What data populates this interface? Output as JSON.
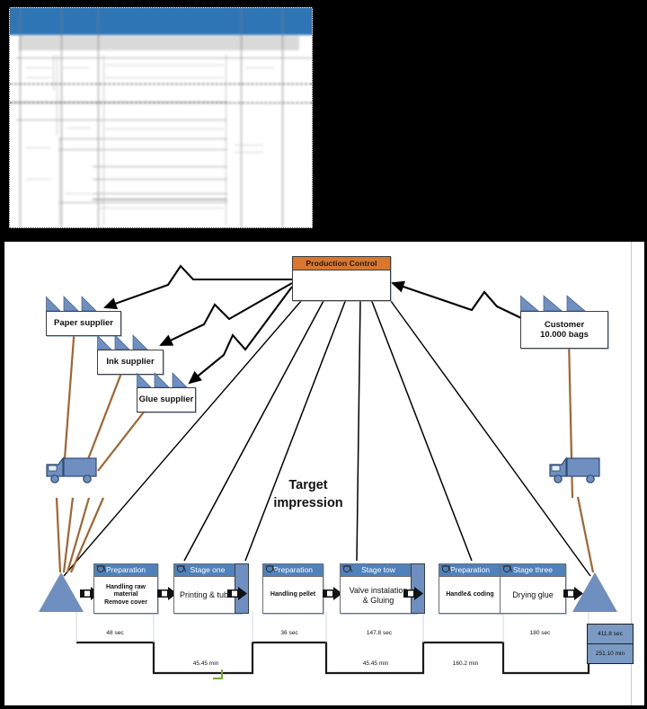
{
  "spreadsheet": {
    "name": "blurred-spreadsheet",
    "header_color": "#2e75b6",
    "subheader_color": "#d9d9d9",
    "visible_text": ""
  },
  "diagram": {
    "type": "value-stream-map",
    "center_label": "Target\nimpression",
    "center_label_line1": "Target",
    "center_label_line2": "impression",
    "production_control": {
      "title": "Production Control",
      "title_color": "#d9772f"
    },
    "suppliers": [
      {
        "label": "Paper supplier",
        "icon": "factory-icon"
      },
      {
        "label": "Ink supplier",
        "icon": "factory-icon"
      },
      {
        "label": "Glue supplier",
        "icon": "factory-icon"
      }
    ],
    "customer": {
      "line1": "Customer",
      "line2": "10.000 bags",
      "icon": "factory-icon"
    },
    "shipping": [
      {
        "name": "inbound-truck",
        "icon": "truck-icon"
      },
      {
        "name": "outbound-truck",
        "icon": "truck-icon"
      }
    ],
    "process_steps": [
      {
        "header": "Preparation",
        "body": "Handling raw material Remove cover",
        "body_line1": "Handling raw",
        "body_line2": "material",
        "body_line3": "Remove cover",
        "operator_icon": "operator-icon",
        "small": true
      },
      {
        "header": "Stage one",
        "body": "Printing & tuber",
        "body_line1": "Printing & tuber",
        "operator_icon": "operator-icon",
        "small": false
      },
      {
        "header": "Preparation",
        "body": "Handling pellet",
        "body_line1": "Handling pellet",
        "operator_icon": "operator-icon",
        "small": true
      },
      {
        "header": "Stage tow",
        "body": "Valve instalation & Gluing",
        "body_line1": "Valve instalation",
        "body_line2": "& Gluing",
        "operator_icon": "operator-icon",
        "small": false
      },
      {
        "header": "Preparation",
        "body": "Handle& coding",
        "body_line1": "Handle& coding",
        "operator_icon": "operator-icon",
        "small": true
      },
      {
        "header": "Stage three",
        "body": "Drying glue",
        "body_line1": "Drying glue",
        "operator_icon": "operator-icon",
        "small": false
      }
    ],
    "timeline": {
      "upper_values": [
        "48 sec",
        "36 sec",
        "147.8 sec",
        "180 sec"
      ],
      "lower_values": [
        "45.45 min",
        "45.45 min",
        "160.2 min"
      ],
      "summary": {
        "value_time": "411.8 sec",
        "lead_time": "251.10 min"
      }
    },
    "colors": {
      "process_header": "#4f81bd",
      "control_header": "#d9772f",
      "inventory": "#6e8fbf",
      "material_flow": "#a5642e",
      "accent_green": "#76a838"
    }
  }
}
